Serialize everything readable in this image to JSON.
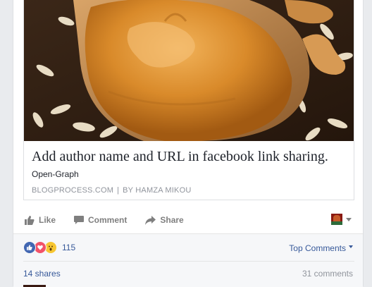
{
  "post": {
    "link": {
      "title": "Add author name and URL in facebook link sharing.",
      "description": "Open-Graph",
      "domain": "BLOGPROCESS.COM",
      "separator": "|",
      "author": "BY HAMZA MIKOU",
      "image_icon": "peanut-butter-photo"
    },
    "actions": {
      "like": "Like",
      "comment": "Comment",
      "share": "Share"
    },
    "reactions": {
      "types": [
        "like",
        "love",
        "wow"
      ],
      "count": "115"
    },
    "top_comments_label": "Top Comments",
    "shares_label": "14 shares",
    "comments_label": "31 comments"
  }
}
